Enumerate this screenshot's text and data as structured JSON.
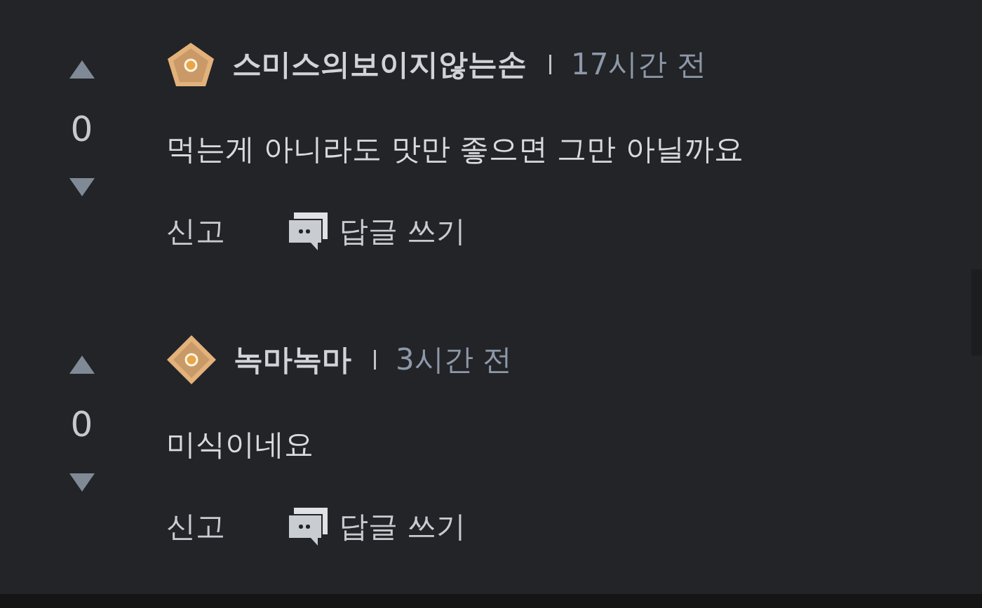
{
  "comments": [
    {
      "votes": "0",
      "badge": {
        "kind": "pentagon"
      },
      "author": "스미스의보이지않는손",
      "time": "17시간 전",
      "body": "먹는게 아니라도 맛만 좋으면 그만 아닐까요",
      "report": "신고",
      "reply": "답글 쓰기"
    },
    {
      "votes": "0",
      "badge": {
        "kind": "diamond"
      },
      "author": "녹마녹마",
      "time": "3시간 전",
      "body": "미식이네요",
      "report": "신고",
      "reply": "답글 쓰기"
    }
  ]
}
